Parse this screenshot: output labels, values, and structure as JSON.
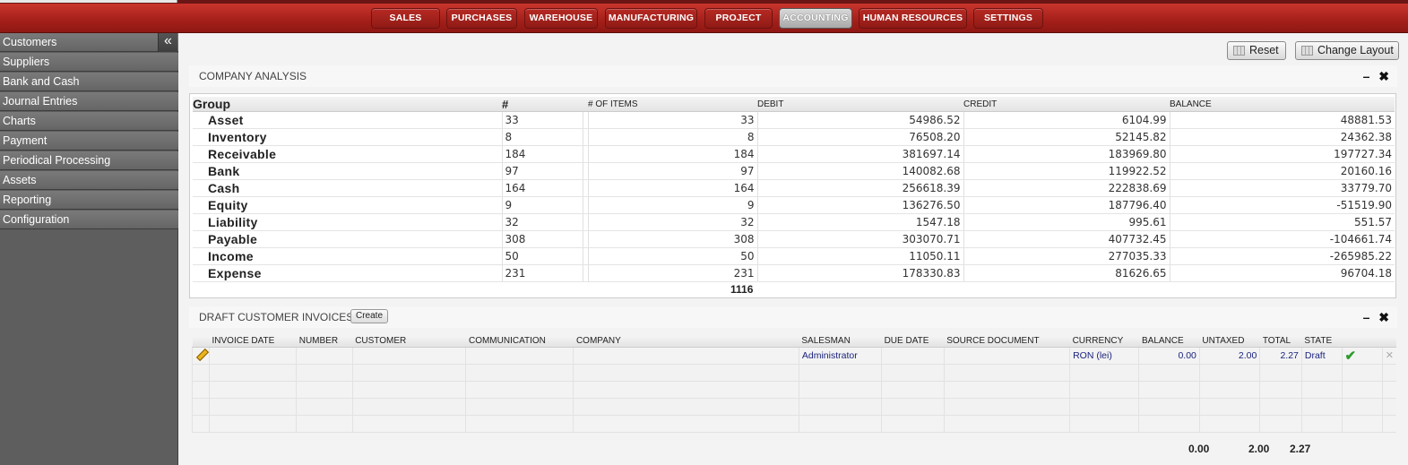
{
  "nav": {
    "items": [
      {
        "label": "SALES"
      },
      {
        "label": "PURCHASES"
      },
      {
        "label": "WAREHOUSE"
      },
      {
        "label": "MANUFACTURING"
      },
      {
        "label": "PROJECT"
      },
      {
        "label": "ACCOUNTING",
        "active": true
      },
      {
        "label": "HUMAN RESOURCES"
      },
      {
        "label": "SETTINGS"
      }
    ]
  },
  "sidebar": {
    "collapse_glyph": "«",
    "items": [
      {
        "label": "Customers"
      },
      {
        "label": "Suppliers"
      },
      {
        "label": "Bank and Cash"
      },
      {
        "label": "Journal Entries"
      },
      {
        "label": "Charts"
      },
      {
        "label": "Payment"
      },
      {
        "label": "Periodical Processing"
      },
      {
        "label": "Assets"
      },
      {
        "label": "Reporting"
      },
      {
        "label": "Configuration"
      }
    ]
  },
  "toolbar": {
    "reset_label": "Reset",
    "change_layout_label": "Change Layout"
  },
  "company_analysis": {
    "title": "COMPANY ANALYSIS",
    "controls": "– ✖",
    "columns": {
      "group": "Group",
      "hash": "#",
      "items": "# OF ITEMS",
      "debit": "DEBIT",
      "credit": "CREDIT",
      "balance": "BALANCE"
    },
    "rows": [
      {
        "group": "Asset",
        "count": "33",
        "items": "33",
        "debit": "54986.52",
        "credit": "6104.99",
        "balance": "48881.53"
      },
      {
        "group": "Inventory",
        "count": "8",
        "items": "8",
        "debit": "76508.20",
        "credit": "52145.82",
        "balance": "24362.38"
      },
      {
        "group": "Receivable",
        "count": "184",
        "items": "184",
        "debit": "381697.14",
        "credit": "183969.80",
        "balance": "197727.34"
      },
      {
        "group": "Bank",
        "count": "97",
        "items": "97",
        "debit": "140082.68",
        "credit": "119922.52",
        "balance": "20160.16"
      },
      {
        "group": "Cash",
        "count": "164",
        "items": "164",
        "debit": "256618.39",
        "credit": "222838.69",
        "balance": "33779.70"
      },
      {
        "group": "Equity",
        "count": "9",
        "items": "9",
        "debit": "136276.50",
        "credit": "187796.40",
        "balance": "-51519.90"
      },
      {
        "group": "Liability",
        "count": "32",
        "items": "32",
        "debit": "1547.18",
        "credit": "995.61",
        "balance": "551.57"
      },
      {
        "group": "Payable",
        "count": "308",
        "items": "308",
        "debit": "303070.71",
        "credit": "407732.45",
        "balance": "-104661.74"
      },
      {
        "group": "Income",
        "count": "50",
        "items": "50",
        "debit": "11050.11",
        "credit": "277035.33",
        "balance": "-265985.22"
      },
      {
        "group": "Expense",
        "count": "231",
        "items": "231",
        "debit": "178330.83",
        "credit": "81626.65",
        "balance": "96704.18"
      }
    ],
    "total_items": "1116"
  },
  "draft_invoices": {
    "title": "DRAFT CUSTOMER INVOICES",
    "create_label": "Create",
    "controls": "– ✖",
    "columns": [
      "INVOICE DATE",
      "NUMBER",
      "CUSTOMER",
      "COMMUNICATION",
      "COMPANY",
      "SALESMAN",
      "DUE DATE",
      "SOURCE DOCUMENT",
      "CURRENCY",
      "BALANCE",
      "UNTAXED",
      "TOTAL",
      "STATE"
    ],
    "rows": [
      {
        "invoice_date": "",
        "number": "",
        "customer": "",
        "communication": "",
        "company": "",
        "salesman": "Administrator",
        "due_date": "",
        "source_document": "",
        "currency": "RON (lei)",
        "balance": "0.00",
        "untaxed": "2.00",
        "total": "2.27",
        "state": "Draft"
      }
    ],
    "totals": {
      "balance": "0.00",
      "untaxed": "2.00",
      "total": "2.27"
    }
  }
}
